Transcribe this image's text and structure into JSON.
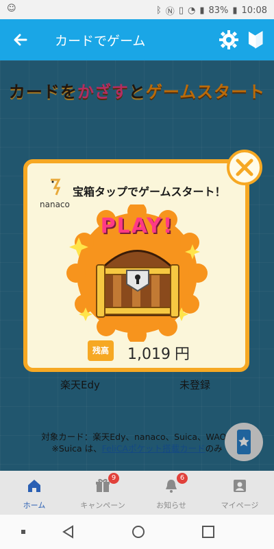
{
  "status_bar": {
    "battery": "83%",
    "time": "10:08"
  },
  "app_bar": {
    "title": "カードでゲーム"
  },
  "background": {
    "headline_parts": [
      "カードを",
      "かざす",
      "と",
      "ゲームスタート"
    ],
    "cards": [
      "楽天Edy",
      "未登録"
    ],
    "note_line1": "対象カード：楽天Edy、nanaco、Suica、WAON",
    "note_line2_prefix": "※Suica は、",
    "note_link": "FeliCAポケット搭載カード",
    "note_line2_suffix": "のみ"
  },
  "dialog": {
    "message": "宝箱タップでゲームスタート！",
    "play_label": "PLAY!",
    "logo_text": "nanaco",
    "balance_label": "残高",
    "balance_value": "1,019",
    "balance_unit": "円"
  },
  "bottom_nav": [
    {
      "label": "ホーム",
      "icon": "home-icon",
      "active": true
    },
    {
      "label": "キャンペーン",
      "icon": "gift-icon",
      "badge": "9"
    },
    {
      "label": "お知らせ",
      "icon": "bell-icon",
      "badge": "6"
    },
    {
      "label": "マイページ",
      "icon": "profile-icon"
    }
  ],
  "colors": {
    "app_bar": "#1aa6e6",
    "dialog_border": "#f6a823",
    "active_nav": "#2a5fb3",
    "badge": "#e1413b"
  }
}
